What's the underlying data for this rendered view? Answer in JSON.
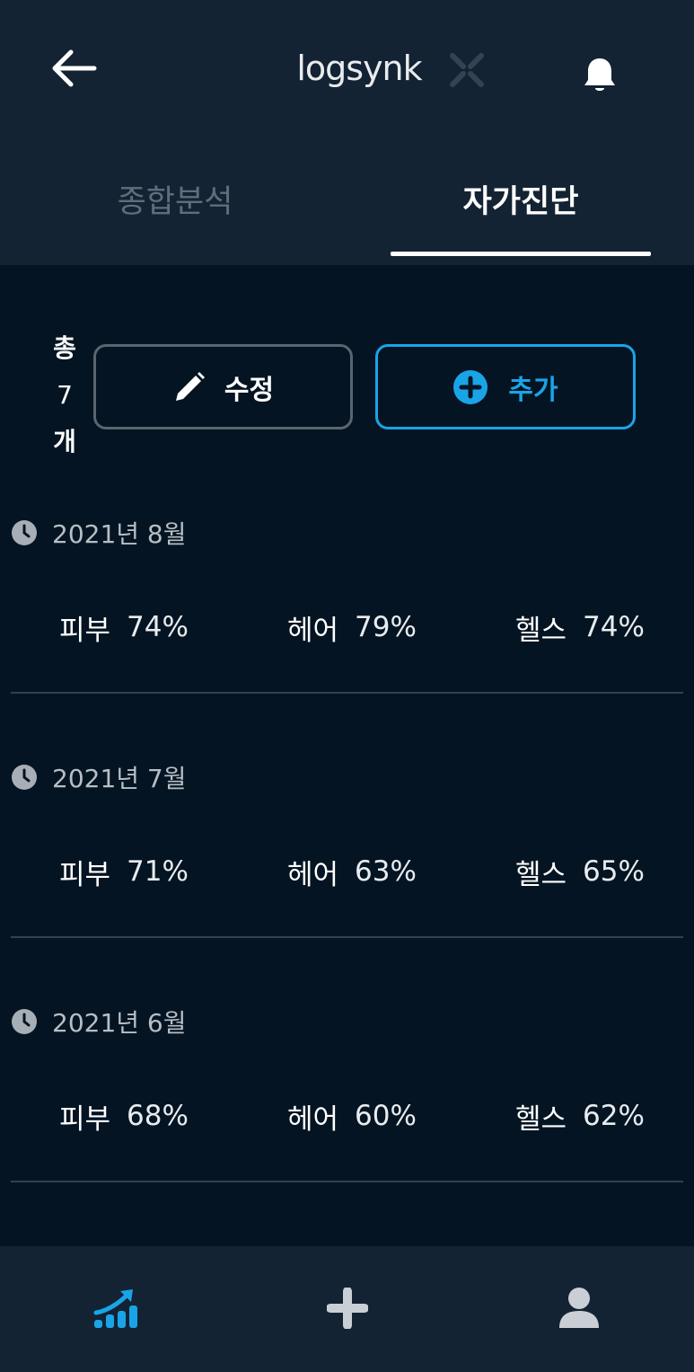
{
  "header": {
    "back_icon": "arrow-left-icon",
    "logo_text": "logsynk",
    "notification_icon": "bell-icon"
  },
  "tabs": [
    {
      "label": "종합분석",
      "active": false
    },
    {
      "label": "자가진단",
      "active": true
    }
  ],
  "toolbar": {
    "count_prefix": "총",
    "count_value": "7",
    "count_suffix": "개",
    "edit_label": "수정",
    "add_label": "추가",
    "accent_color": "#1aa4e8"
  },
  "records": [
    {
      "date": "2021년 8월",
      "metrics": [
        {
          "name": "피부",
          "value": "74%"
        },
        {
          "name": "헤어",
          "value": "79%"
        },
        {
          "name": "헬스",
          "value": "74%"
        }
      ]
    },
    {
      "date": "2021년 7월",
      "metrics": [
        {
          "name": "피부",
          "value": "71%"
        },
        {
          "name": "헤어",
          "value": "63%"
        },
        {
          "name": "헬스",
          "value": "65%"
        }
      ]
    },
    {
      "date": "2021년 6월",
      "metrics": [
        {
          "name": "피부",
          "value": "68%"
        },
        {
          "name": "헤어",
          "value": "60%"
        },
        {
          "name": "헬스",
          "value": "62%"
        }
      ]
    }
  ],
  "bottom_nav": [
    {
      "icon": "chart-trend-icon",
      "active": true
    },
    {
      "icon": "plus-icon",
      "active": false
    },
    {
      "icon": "user-icon",
      "active": false
    }
  ]
}
